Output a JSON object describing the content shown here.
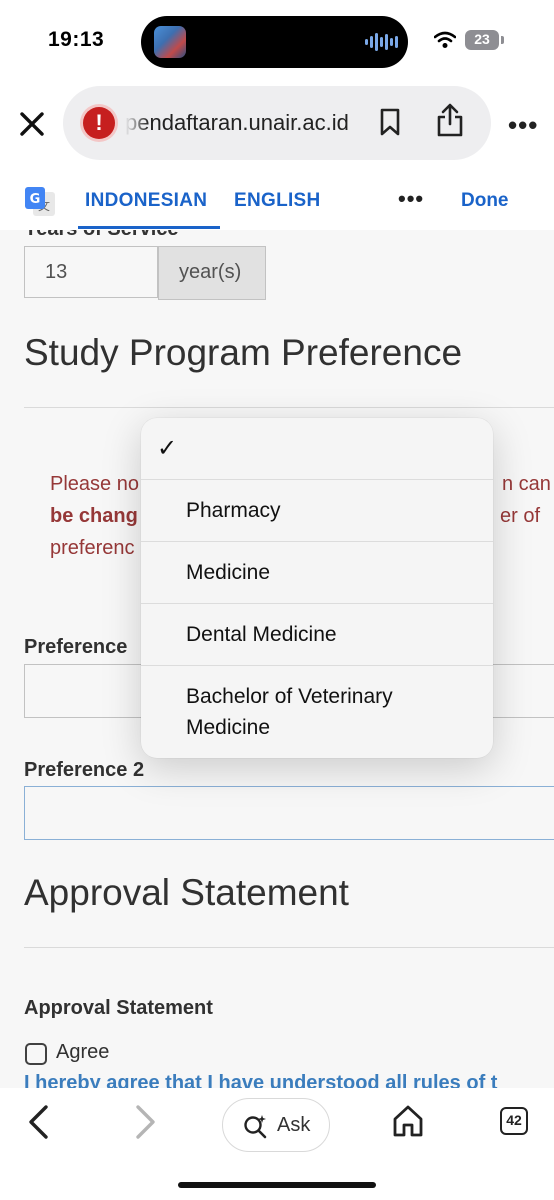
{
  "status_bar": {
    "time": "19:13",
    "battery": "23"
  },
  "browser": {
    "url": "pendaftaran.unair.ac.id",
    "more_label": "•••"
  },
  "translate_bar": {
    "lang_source": "INDONESIAN",
    "lang_target": "ENGLISH",
    "more_label": "•••",
    "done_label": "Done"
  },
  "form": {
    "years_label": "Years of Service",
    "years_value": "13",
    "years_unit": "year(s)",
    "study_heading": "Study Program Preference",
    "notice_line1_left": "Please no",
    "notice_line1_right": "n can r",
    "notice_line2_left": "be chang",
    "notice_line2_right": "er of",
    "notice_line3_left": "preferenc",
    "pref1_label": "Preference",
    "pref2_label": "Preference 2",
    "approval_heading": "Approval Statement",
    "approval_label": "Approval Statement",
    "agree_label": "Agree",
    "agree_text": "I hereby agree that I have understood all rules of t"
  },
  "dropdown": {
    "checkmark": "✓",
    "options": [
      "Pharmacy",
      "Medicine",
      "Dental Medicine",
      "Bachelor of Veterinary",
      "Medicine"
    ]
  },
  "bottom_bar": {
    "ask_label": "Ask",
    "tab_count": "42"
  },
  "colors": {
    "accent": "#1a63c9",
    "notice": "#9b3a3a",
    "link": "#3d82c4",
    "warning": "#c61f1f"
  }
}
